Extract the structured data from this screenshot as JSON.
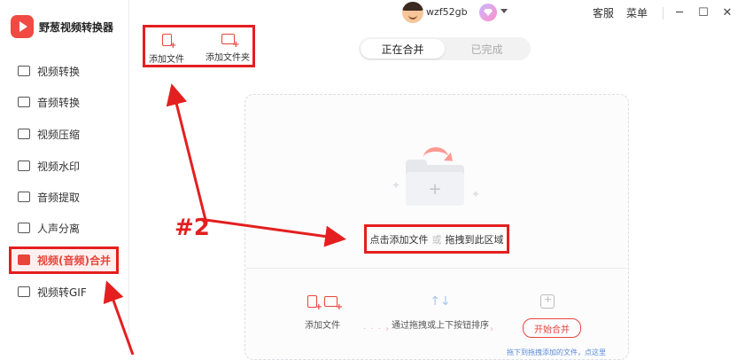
{
  "app": {
    "title": "野葱视频转换器"
  },
  "sidebar": {
    "items": [
      {
        "label": "视频转换",
        "icon": "video-convert-icon"
      },
      {
        "label": "音频转换",
        "icon": "audio-convert-icon"
      },
      {
        "label": "视频压缩",
        "icon": "video-compress-icon"
      },
      {
        "label": "视频水印",
        "icon": "watermark-icon"
      },
      {
        "label": "音频提取",
        "icon": "audio-extract-icon"
      },
      {
        "label": "人声分离",
        "icon": "voice-separate-icon"
      },
      {
        "label": "视频(音频)合并",
        "icon": "merge-icon",
        "active": true
      },
      {
        "label": "视频转GIF",
        "icon": "gif-icon"
      }
    ]
  },
  "header": {
    "username": "wzf52gb",
    "service_label": "客服",
    "menu_label": "菜单",
    "window": {
      "minimize": "─",
      "maximize": "☐",
      "close": "✕"
    }
  },
  "toolbar": {
    "add_file_label": "添加文件",
    "add_folder_label": "添加文件夹"
  },
  "tabs": {
    "merging": "正在合并",
    "done": "已完成"
  },
  "dropzone": {
    "plus": "+",
    "text_click": "点击添加文件",
    "text_or": "或",
    "text_drag": "拖拽到此区域"
  },
  "steps": {
    "step1_label": "添加文件",
    "step2_label": "通过拖拽或上下按钮排序",
    "start_button": "开始合并",
    "hint": "拖下到拖拽添加的文件，点这里"
  },
  "annotations": {
    "label": "#2"
  },
  "colors": {
    "accent": "#e8453c",
    "annotation": "#e41f1f"
  }
}
